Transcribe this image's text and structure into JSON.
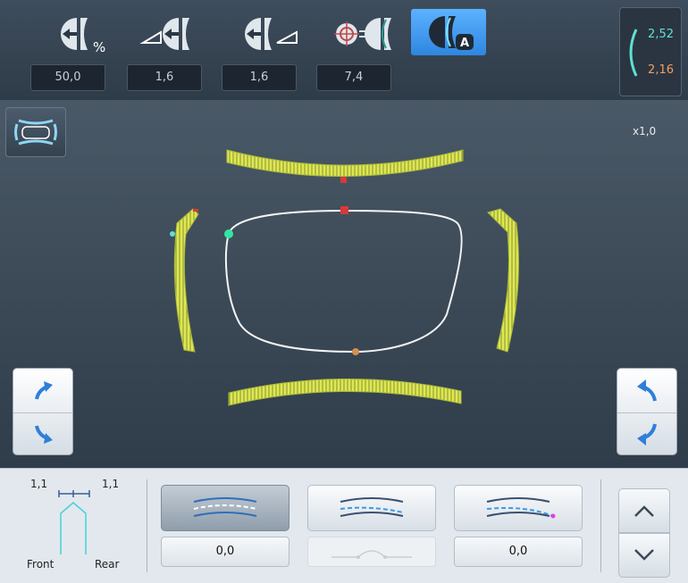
{
  "toolbar": {
    "tools": [
      {
        "name": "bevel-position-percent",
        "icon": "bevel-percent-icon",
        "value": "50,0"
      },
      {
        "name": "bevel-offset-front",
        "icon": "bevel-front-icon",
        "value": "1,6"
      },
      {
        "name": "bevel-offset-rear",
        "icon": "bevel-rear-icon",
        "value": "1,6"
      },
      {
        "name": "bevel-curve",
        "icon": "bevel-curve-target-icon",
        "value": "7,4"
      },
      {
        "name": "auto-bevel",
        "icon": "auto-bevel-icon",
        "badge": "A",
        "active": true
      }
    ],
    "percent_symbol": "%",
    "thickness": {
      "front": "2,52",
      "rear": "2,16"
    }
  },
  "view": {
    "zoom": "x1,0"
  },
  "profile": {
    "left_value": "1,1",
    "right_value": "1,1",
    "front_label": "Front",
    "rear_label": "Rear"
  },
  "modes": [
    {
      "name": "bevel-mode-center",
      "value": "0,0",
      "selected": true
    },
    {
      "name": "bevel-mode-front",
      "value": "",
      "disabled": true
    },
    {
      "name": "bevel-mode-rear",
      "value": "0,0"
    }
  ],
  "colors": {
    "accent_blue": "#3a93ee",
    "bevel_yellow": "#d8e34a",
    "cyan": "#5fe0d4",
    "orange": "#f0a060",
    "marker_red": "#d43a3a",
    "marker_green": "#33e6a0",
    "marker_orange": "#d49050"
  }
}
